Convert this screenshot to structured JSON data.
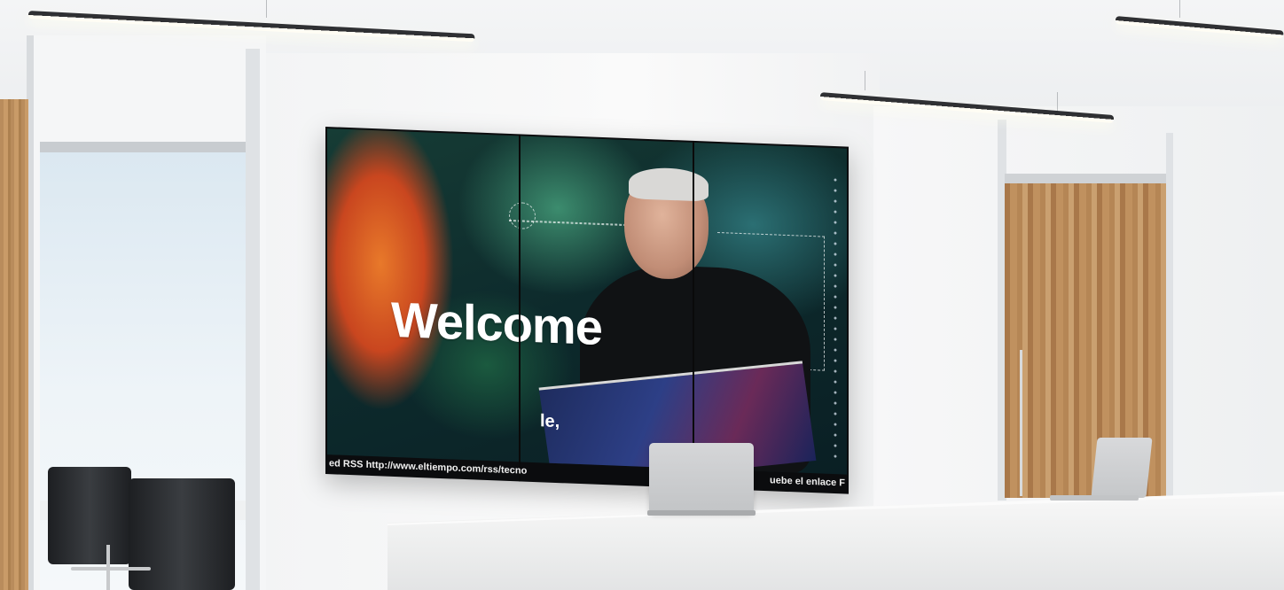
{
  "display": {
    "welcome_text": "Welcome",
    "caption_text": "le,",
    "ticker_left": "ed RSS http://www.eltiempo.com/rss/tecno",
    "ticker_right": "uebe el enlace F"
  }
}
